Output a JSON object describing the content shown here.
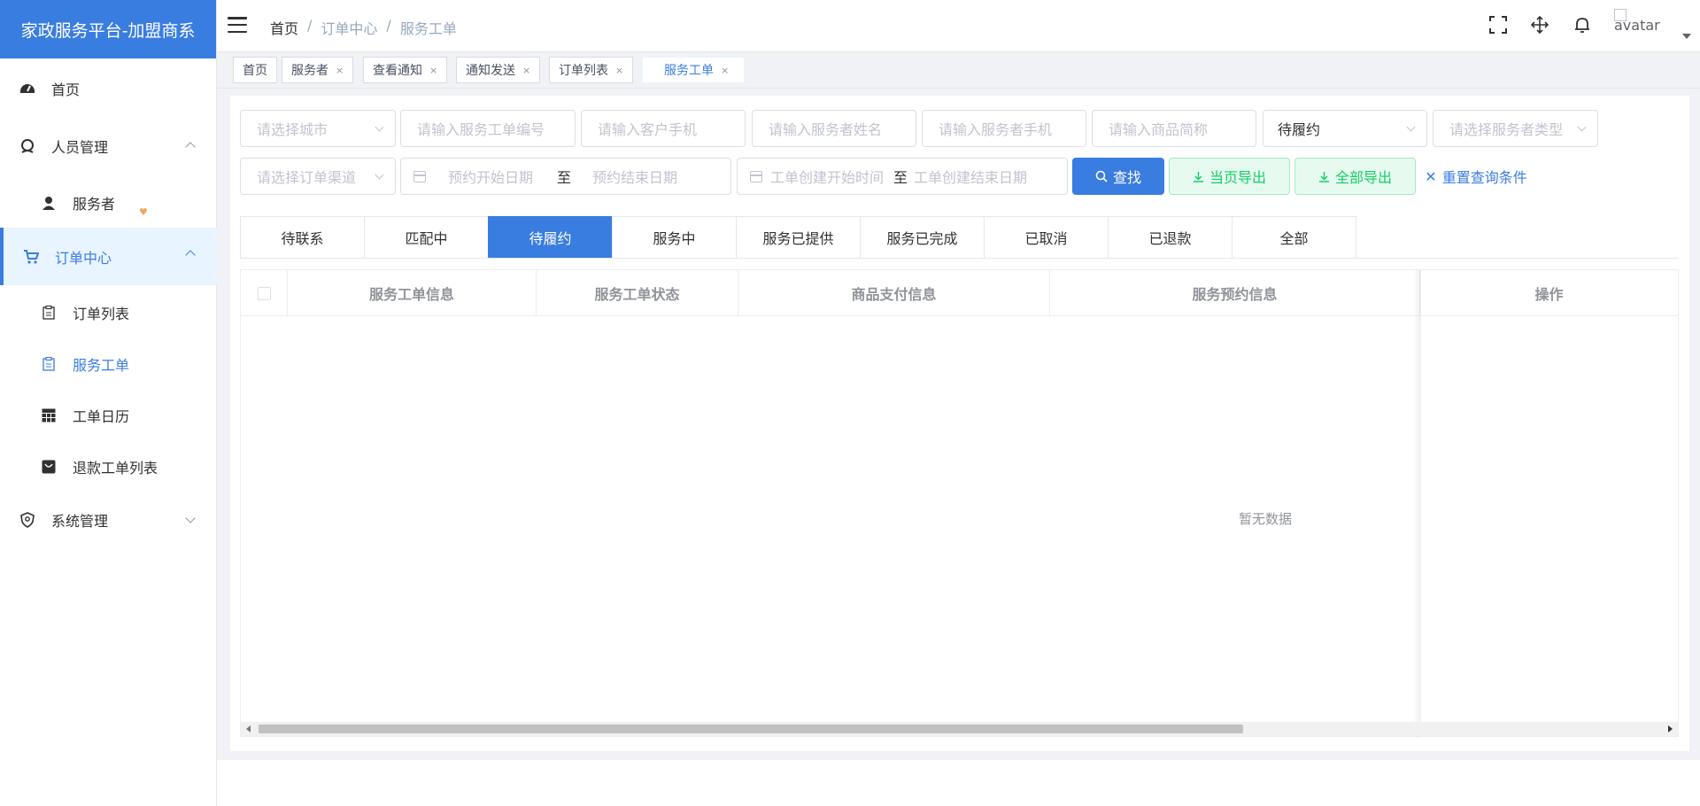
{
  "sidebar": {
    "brand": "家政服务平台-加盟商系",
    "items": [
      {
        "label": "首页",
        "icon": "dashboard-icon"
      },
      {
        "label": "人员管理",
        "icon": "people-icon"
      },
      {
        "label": "服务者",
        "icon": "user-icon"
      },
      {
        "label": "订单中心",
        "icon": "cart-icon"
      },
      {
        "label": "订单列表",
        "icon": "clipboard-icon"
      },
      {
        "label": "服务工单",
        "icon": "clipboard-icon"
      },
      {
        "label": "工单日历",
        "icon": "table-icon"
      },
      {
        "label": "退款工单列表",
        "icon": "bag-icon"
      },
      {
        "label": "系统管理",
        "icon": "shield-icon"
      }
    ]
  },
  "header": {
    "breadcrumb": [
      "首页",
      "/",
      "订单中心",
      "/",
      "服务工单"
    ],
    "avatar_alt": "avatar"
  },
  "tags": [
    {
      "label": "首页",
      "closable": false
    },
    {
      "label": "服务者",
      "closable": true
    },
    {
      "label": "查看通知",
      "closable": true
    },
    {
      "label": "通知发送",
      "closable": true
    },
    {
      "label": "订单列表",
      "closable": true
    },
    {
      "label": "服务工单",
      "closable": true,
      "active": true
    }
  ],
  "tag_close": "×",
  "filters": {
    "city_placeholder": "请选择城市",
    "order_no_placeholder": "请输入服务工单编号",
    "customer_phone_placeholder": "请输入客户手机",
    "provider_name_placeholder": "请输入服务者姓名",
    "provider_phone_placeholder": "请输入服务者手机",
    "product_placeholder": "请输入商品简称",
    "status_value": "待履约",
    "provider_type_placeholder": "请选择服务者类型",
    "channel_placeholder": "请选择订单渠道",
    "appoint_start": "预约开始日期",
    "appoint_end": "预约结束日期",
    "create_start": "工单创建开始时间",
    "create_end": "工单创建结束日期",
    "range_sep": "至"
  },
  "buttons": {
    "search": "查找",
    "export_page": "当页导出",
    "export_all": "全部导出",
    "reset": "重置查询条件"
  },
  "status_tabs": [
    "待联系",
    "匹配中",
    "待履约",
    "服务中",
    "服务已提供",
    "服务已完成",
    "已取消",
    "已退款",
    "全部"
  ],
  "active_status_tab": "待履约",
  "table": {
    "columns": [
      "服务工单信息",
      "服务工单状态",
      "商品支付信息",
      "服务预约信息",
      "操作"
    ],
    "empty_text": "暂无数据"
  },
  "colors": {
    "primary": "#3a7de0",
    "success": "#13ce66",
    "heart": "#f4a460"
  }
}
